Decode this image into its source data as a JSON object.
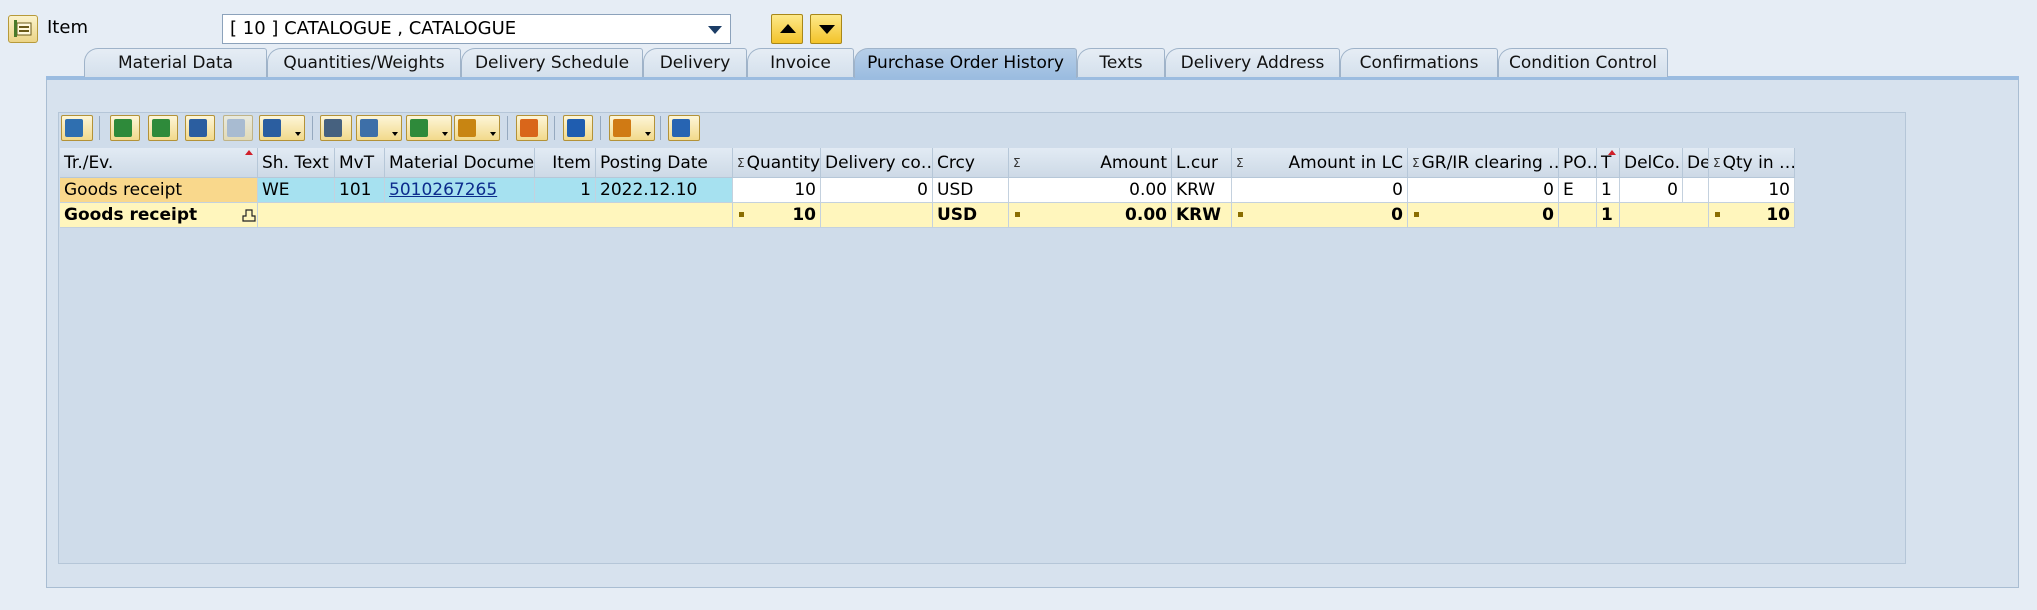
{
  "header": {
    "item_label": "Item",
    "item_select_value": "[ 10 ] CATALOGUE , CATALOGUE"
  },
  "tabs": [
    {
      "label": "Material Data",
      "active": false
    },
    {
      "label": "Quantities/Weights",
      "active": false
    },
    {
      "label": "Delivery Schedule",
      "active": false
    },
    {
      "label": "Delivery",
      "active": false
    },
    {
      "label": "Invoice",
      "active": false
    },
    {
      "label": "Purchase Order History",
      "active": true
    },
    {
      "label": "Texts",
      "active": false
    },
    {
      "label": "Delivery Address",
      "active": false
    },
    {
      "label": "Confirmations",
      "active": false
    },
    {
      "label": "Condition Control",
      "active": false
    }
  ],
  "toolbar": {
    "icons": [
      "details-icon",
      "align-left-icon",
      "filter-level-icon",
      "find-icon",
      "find-next-icon",
      "filter-icon",
      "print-icon",
      "view-icon",
      "export-icon",
      "layout-icon",
      "graphic-icon",
      "info-icon",
      "variant-icon",
      "refresh-icon"
    ]
  },
  "table": {
    "columns": {
      "tr_ev": "Tr./Ev.",
      "sh_text": "Sh. Text",
      "mvt": "MvT",
      "material_doc": "Material Docume…",
      "item": "Item",
      "posting_date": "Posting Date",
      "quantity": "Quantity",
      "delivery_cost": "Delivery co…",
      "crcy": "Crcy",
      "amount": "Amount",
      "l_cur": "L.cur",
      "amount_lc": "Amount in LC",
      "gr_ir": "GR/IR clearing …",
      "po": "PO…",
      "t": "T",
      "delco": "DelCo…",
      "de": "De",
      "qty_in": "Qty in …"
    },
    "rows": [
      {
        "tr_ev": "Goods receipt",
        "sh_text": "WE",
        "mvt": "101",
        "material_doc": "5010267265",
        "item": "1",
        "posting_date": "2022.12.10",
        "quantity": "10",
        "delivery_cost": "0",
        "crcy": "USD",
        "amount": "0.00",
        "l_cur": "KRW",
        "amount_lc": "0",
        "gr_ir": "0",
        "po": "E",
        "t": "1",
        "delco": "0",
        "de": "",
        "qty_in": "10"
      }
    ],
    "total": {
      "tr_ev": "Goods receipt",
      "quantity": "10",
      "crcy": "USD",
      "amount": "0.00",
      "l_cur": "KRW",
      "amount_lc": "0",
      "gr_ir": "0",
      "t": "1",
      "qty_in": "10"
    }
  }
}
